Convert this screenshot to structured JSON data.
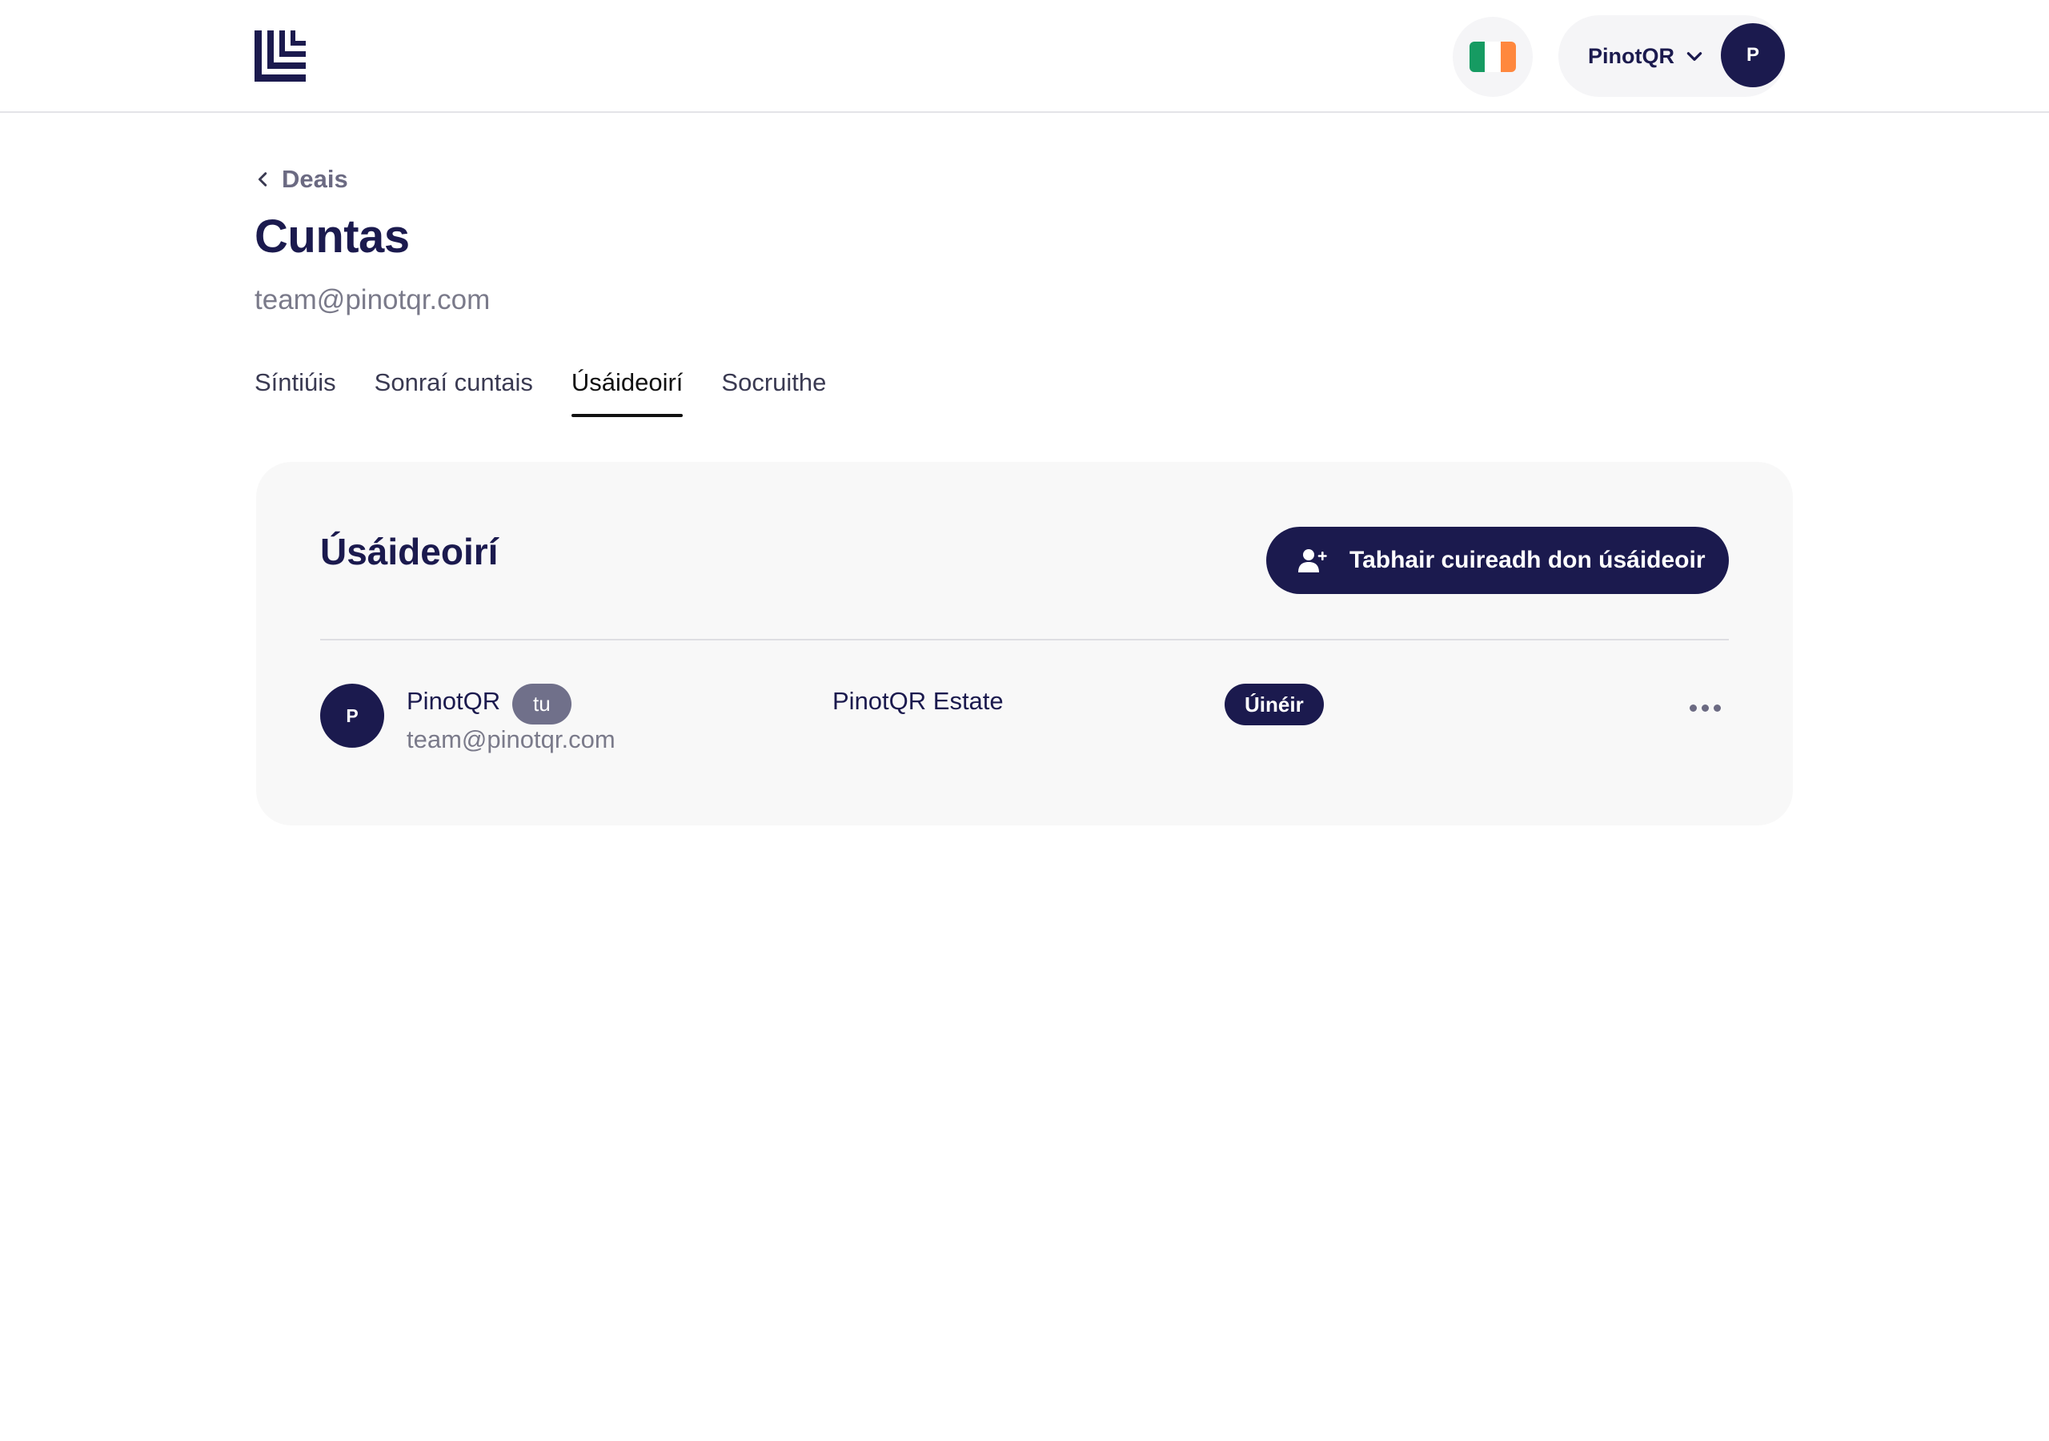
{
  "header": {
    "logo_icon": "logo-icon",
    "language_flag": "ireland-flag-icon",
    "flag_colors": [
      "#169b62",
      "#ffffff",
      "#ff883e"
    ],
    "account_name": "PinotQR",
    "account_avatar_initial": "P"
  },
  "page": {
    "back_label": "Deais",
    "title": "Cuntas",
    "subtitle": "team@pinotqr.com"
  },
  "tabs": [
    {
      "label": "Síntiúis",
      "active": false
    },
    {
      "label": "Sonraí cuntais",
      "active": false
    },
    {
      "label": "Úsáideoirí",
      "active": true
    },
    {
      "label": "Socruithe",
      "active": false
    }
  ],
  "users_card": {
    "title": "Úsáideoirí",
    "invite_button_label": "Tabhair cuireadh don úsáideoir",
    "rows": [
      {
        "avatar_initial": "P",
        "name": "PinotQR",
        "you_badge": "tu",
        "email": "team@pinotqr.com",
        "organization": "PinotQR Estate",
        "role": "Úinéir"
      }
    ]
  },
  "colors": {
    "brand": "#1b1a4e",
    "card_bg": "#f8f8f8",
    "muted_text": "#7a7a8a"
  }
}
